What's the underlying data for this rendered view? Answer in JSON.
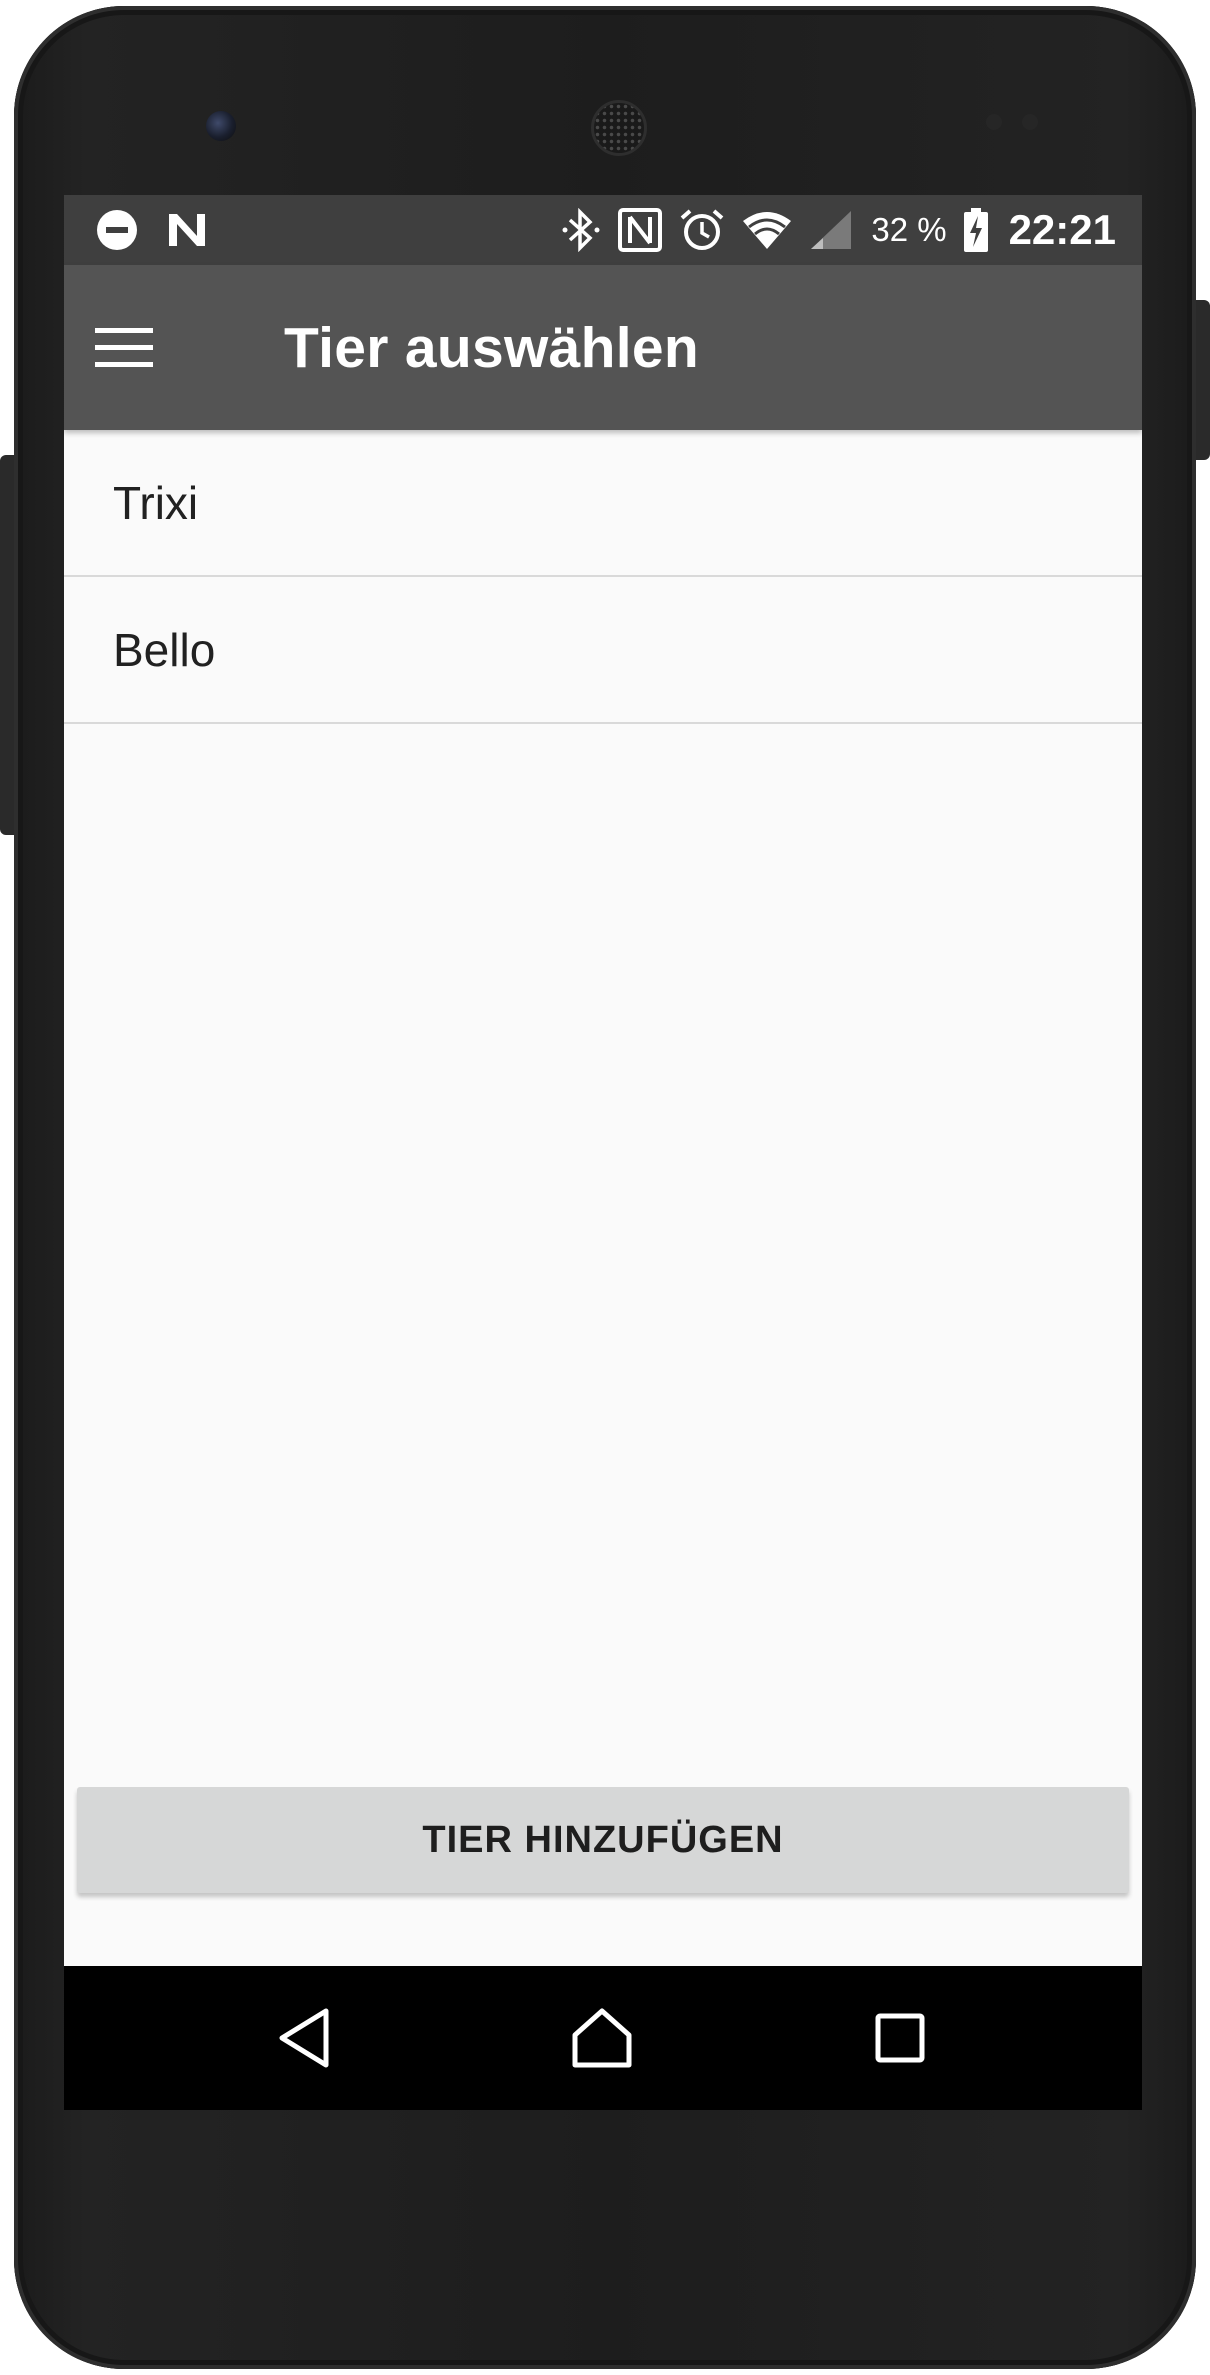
{
  "status_bar": {
    "icons": [
      "do-not-disturb-icon",
      "n-notification-icon",
      "bluetooth-icon",
      "nfc-icon",
      "alarm-icon",
      "wifi-icon",
      "cell-signal-icon",
      "battery-charging-icon"
    ],
    "battery_percent": "32 %",
    "time": "22:21"
  },
  "toolbar": {
    "menu_icon": "hamburger-menu-icon",
    "title": "Tier auswählen"
  },
  "animals": [
    {
      "name": "Trixi"
    },
    {
      "name": "Bello"
    }
  ],
  "add_button": {
    "label": "TIER HINZUFÜGEN"
  },
  "navigation": {
    "back_icon": "back-triangle-icon",
    "home_icon": "home-icon",
    "recent_icon": "recent-apps-icon"
  },
  "colors": {
    "status_bar": "#3f3f3f",
    "toolbar": "#545454",
    "background": "#fafafa",
    "button": "#d6d7d7",
    "nav_bar": "#000000"
  }
}
